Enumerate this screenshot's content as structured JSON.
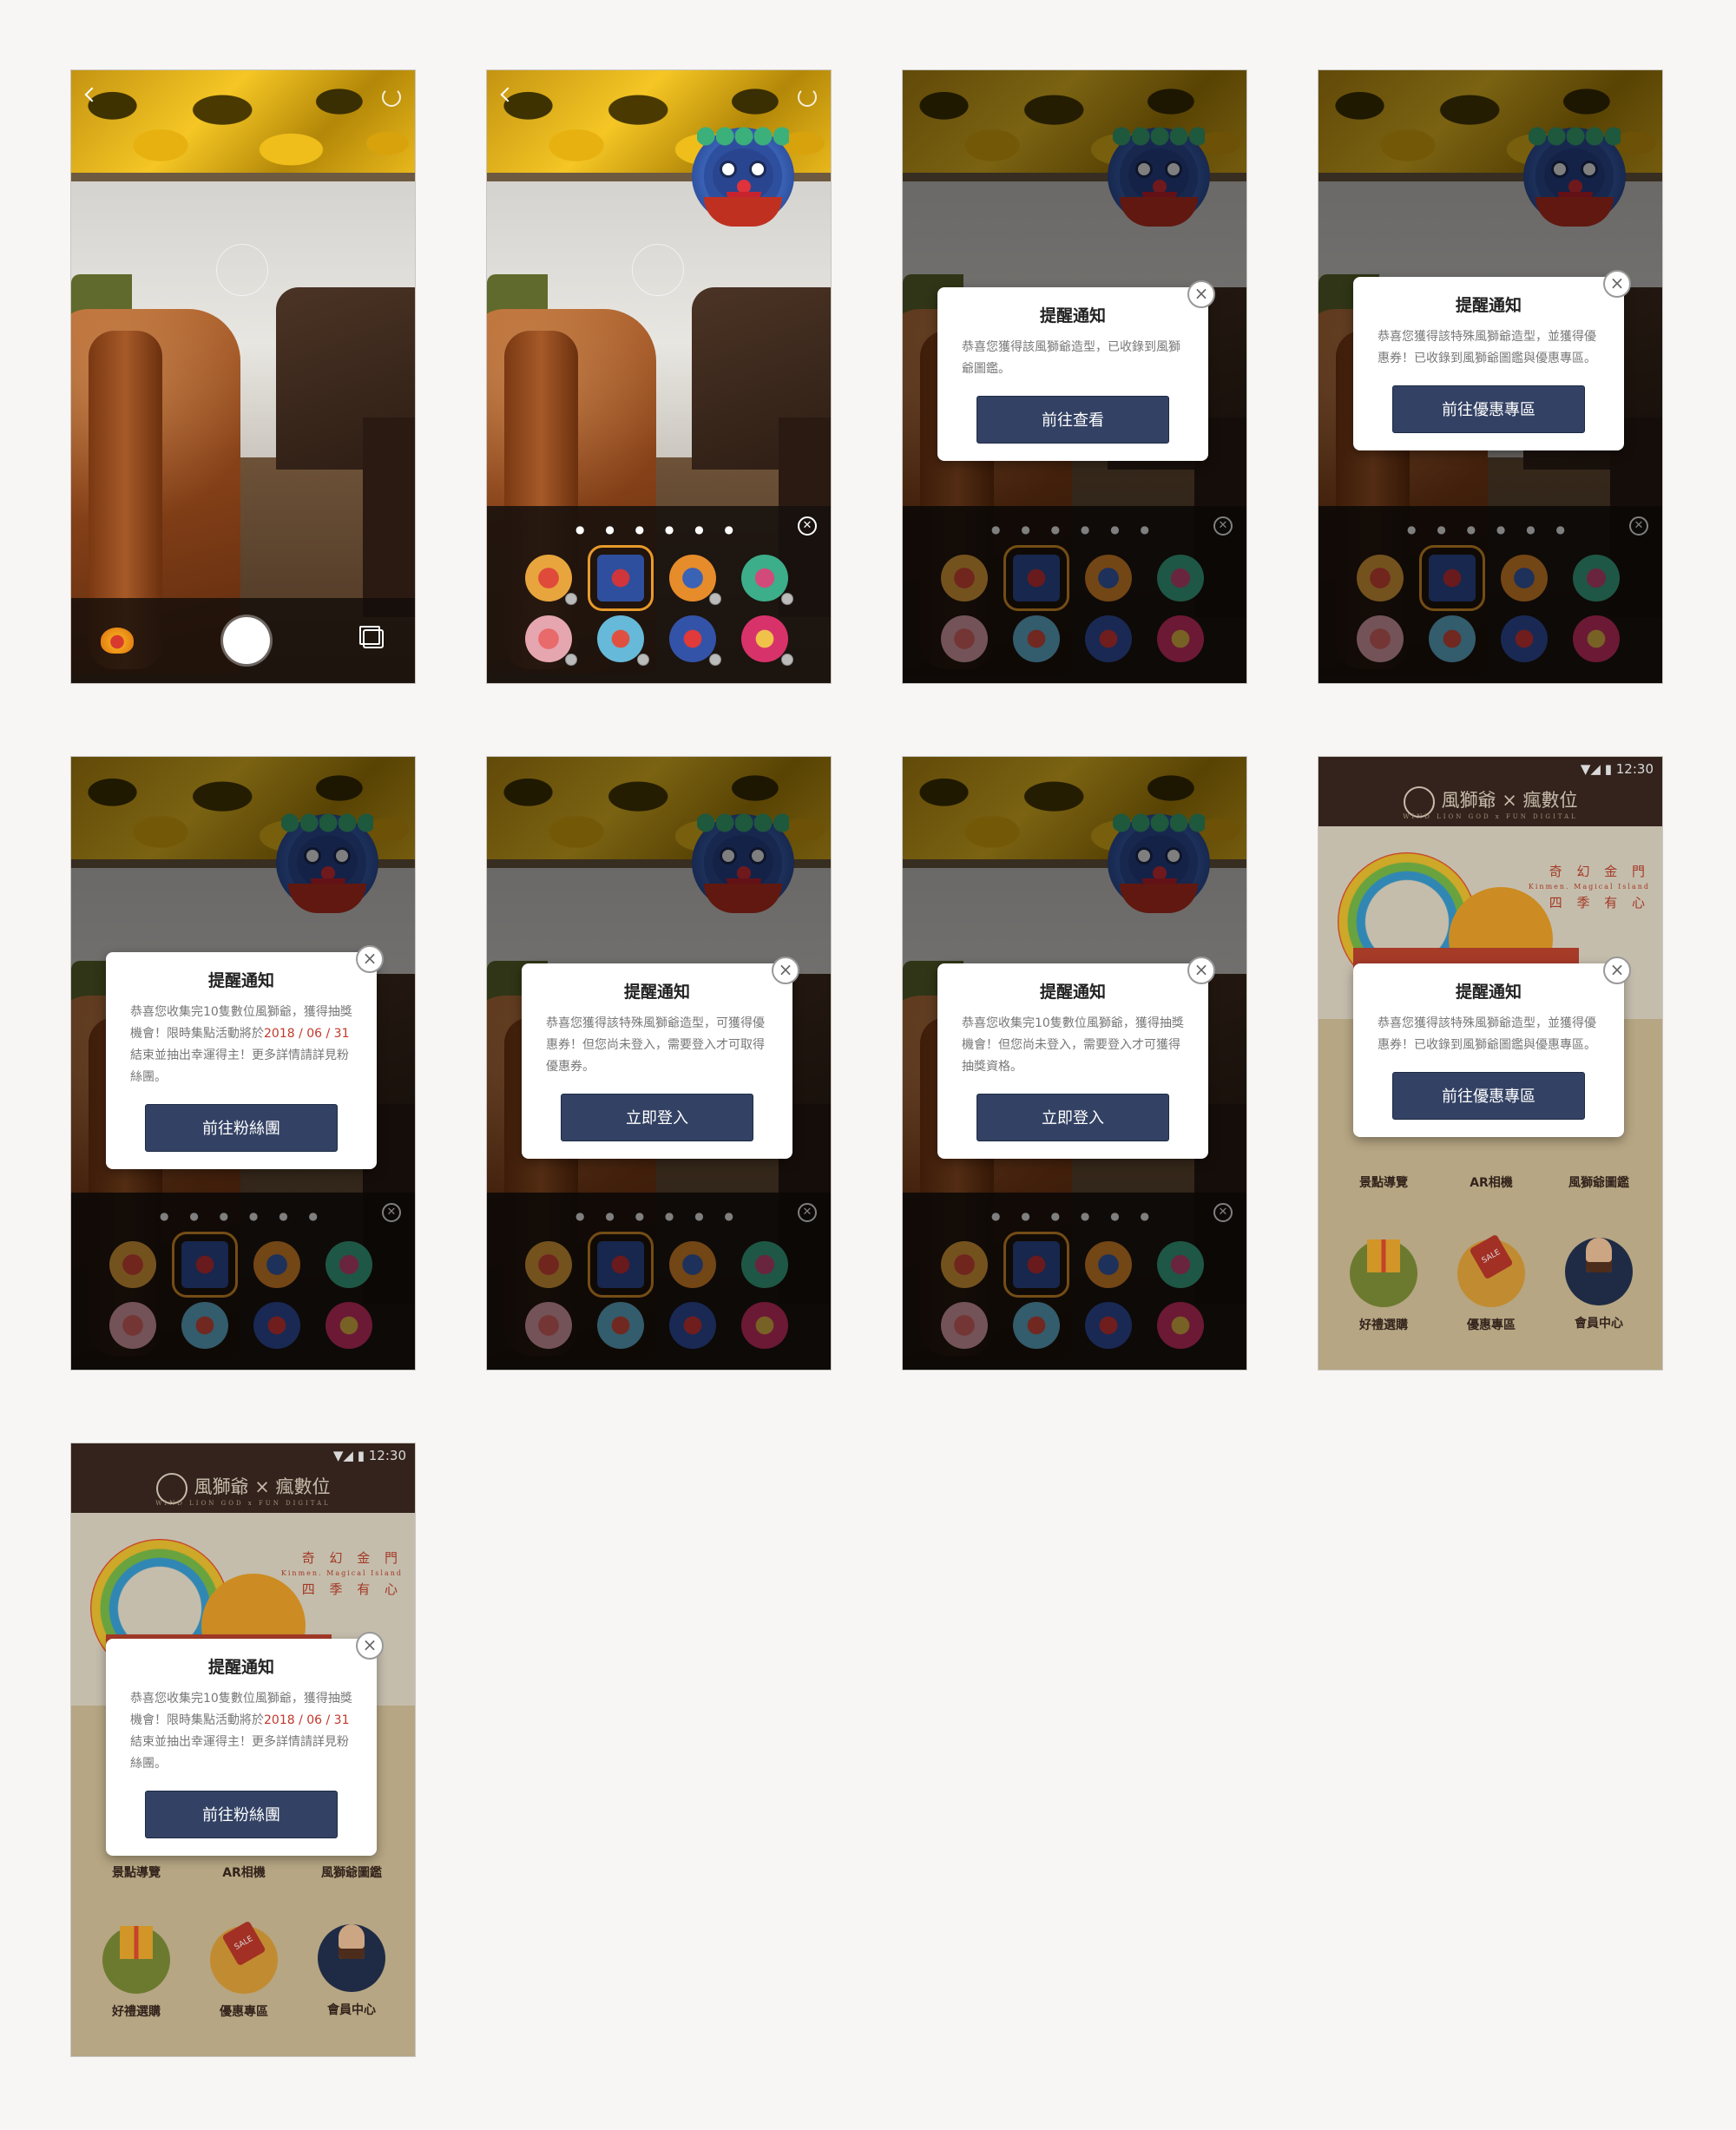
{
  "camera": {
    "back_icon": "back-icon",
    "switch_icon": "switch-camera-icon",
    "gallery_icon": "gallery-icon"
  },
  "dialog_title": "提醒通知",
  "dialogs": {
    "collected": {
      "message": "恭喜您獲得該風獅爺造型，已收錄到風獅爺圖鑑。",
      "button": "前往查看"
    },
    "special": {
      "message": "恭喜您獲得該特殊風獅爺造型，並獲得優惠券！已收錄到風獅爺圖鑑與優惠專區。",
      "button": "前往優惠專區"
    },
    "lottery": {
      "message_a": "恭喜您收集完10隻數位風獅爺，獲得抽獎機會！限時集點活動將於",
      "date": "2018 / 06 / 31",
      "message_b": "結束並抽出幸運得主！更多詳情請詳見粉絲團。",
      "button": "前往粉絲團"
    },
    "login_coupon": {
      "message": "恭喜您獲得該特殊風獅爺造型，可獲得優惠券！但您尚未登入，需要登入才可取得優惠券。",
      "button": "立即登入"
    },
    "login_lottery": {
      "message": "恭喜您收集完10隻數位風獅爺，獲得抽獎機會！但您尚未登入，需要登入才可獲得抽獎資格。",
      "button": "立即登入"
    }
  },
  "tray": {
    "dots": "● ● ● ● ● ●",
    "close": "✕"
  },
  "home": {
    "time": "12:30",
    "app_name": "風獅爺 × 瘋數位",
    "app_sub": "WIND LION GOD x FUN DIGITAL",
    "slogan_1": "奇 幻 金 門",
    "slogan_2": "Kinmen. Magical Island",
    "slogan_3": "四 季 有 心",
    "menu": [
      "景點導覽",
      "AR相機",
      "風獅爺圖鑑"
    ],
    "icons": [
      "好禮選購",
      "優惠專區",
      "會員中心"
    ]
  },
  "colors": {
    "button": "#334264",
    "accent": "#e89a2b",
    "status_bar": "#3c2a21"
  }
}
